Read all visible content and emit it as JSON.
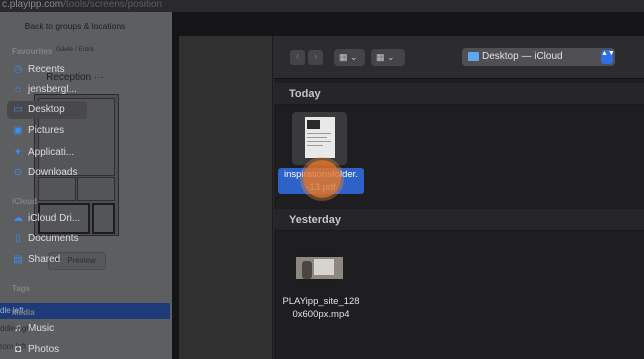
{
  "browser": {
    "url_host": "c.playipp.com",
    "url_path": "/tools/screens/position"
  },
  "app": {
    "back_link": "Back to groups & locations",
    "breadcrumb": "Gävle / Entré",
    "screen_title": "Reception",
    "more": "···",
    "preview_label": "Preview",
    "list": [
      "dle left",
      "ddle right",
      "tom left"
    ]
  },
  "dialog": {
    "sidebar": {
      "favourites_label": "Favourites",
      "favourites": [
        {
          "label": "Recents",
          "icon": "clock-icon"
        },
        {
          "label": "jensbergl...",
          "icon": "home-icon"
        },
        {
          "label": "Desktop",
          "icon": "desktop-icon",
          "active": true
        },
        {
          "label": "Pictures",
          "icon": "pictures-icon"
        },
        {
          "label": "Applicati...",
          "icon": "applications-icon"
        },
        {
          "label": "Downloads",
          "icon": "downloads-icon"
        }
      ],
      "icloud_label": "iCloud",
      "icloud": [
        {
          "label": "iCloud Dri...",
          "icon": "cloud-icon"
        },
        {
          "label": "Documents",
          "icon": "document-icon"
        },
        {
          "label": "Shared",
          "icon": "shared-folder-icon"
        }
      ],
      "tags_label": "Tags",
      "media_label": "Media",
      "media": [
        {
          "label": "Music",
          "icon": "music-icon"
        },
        {
          "label": "Photos",
          "icon": "camera-icon"
        }
      ]
    },
    "toolbar": {
      "location": "Desktop — iCloud",
      "back": "‹",
      "forward": "›",
      "view_icon": "▦",
      "group_icon": "▦",
      "chevron": "⌄",
      "stepper": "▲▼"
    },
    "groups": [
      {
        "label": "Today",
        "files": [
          {
            "name_line1": "inspirationsfolder.",
            "name_line2": "-13.pdf",
            "selected": true
          }
        ]
      },
      {
        "label": "Yesterday",
        "files": [
          {
            "name_line1": "PLAYipp_site_128",
            "name_line2": "0x600px.mp4",
            "selected": false
          }
        ]
      }
    ]
  },
  "colors": {
    "accent": "#3a8ff5",
    "selection": "#2f62c8",
    "cursor": "#e67828"
  }
}
